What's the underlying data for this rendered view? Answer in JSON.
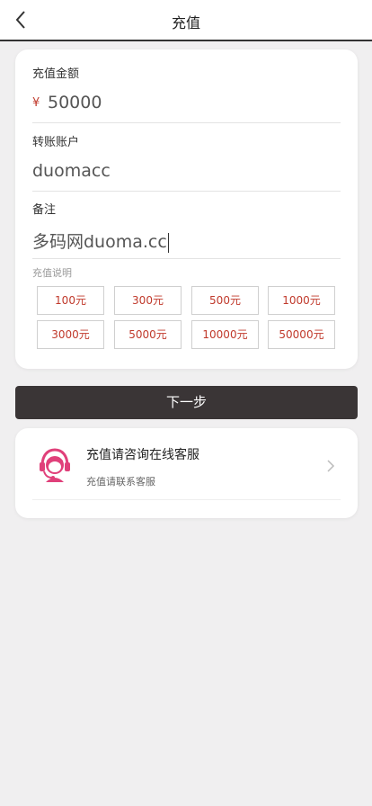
{
  "header": {
    "title": "充值"
  },
  "form": {
    "amount_label": "充值金额",
    "currency_symbol": "¥",
    "amount_value": "50000",
    "account_label": "转账账户",
    "account_value": "duomacc",
    "remark_label": "备注",
    "remark_value": "多码网duoma.cc",
    "description_label": "充值说明",
    "amount_options": [
      "100元",
      "300元",
      "500元",
      "1000元",
      "3000元",
      "5000元",
      "10000元",
      "50000元"
    ]
  },
  "next_button": {
    "label": "下一步"
  },
  "service": {
    "title": "充值请咨询在线客服",
    "subtitle": "充值请联系客服",
    "avatar_icon": "customer-service-icon"
  },
  "colors": {
    "accent": "#c0392b",
    "button_bg": "#3a3536",
    "avatar": "#e0407a"
  }
}
